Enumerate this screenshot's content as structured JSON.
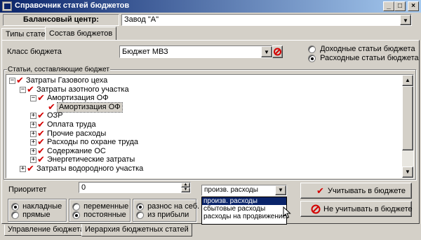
{
  "window": {
    "title": "Справочник статей бюджетов",
    "controls": [
      "_",
      "□",
      "×"
    ]
  },
  "balance_center": {
    "label": "Балансовый центр:",
    "value": "Завод \"А\""
  },
  "top_tabs": [
    {
      "label": "Типы статей",
      "active": false
    },
    {
      "label": "Состав бюджетов",
      "active": true
    }
  ],
  "budget_class": {
    "label": "Класс бюджета",
    "value": "Бюджет МВЗ"
  },
  "budget_type": {
    "options": [
      {
        "label": "Доходные статьи бюджета",
        "selected": false
      },
      {
        "label": "Расходные статьи бюджета",
        "selected": true
      }
    ]
  },
  "tree_group_label": "Статьи, составляющие бюджет",
  "tree": [
    {
      "label": "Затраты Газового цеха",
      "expander": "−",
      "level": 0
    },
    {
      "label": "Затраты азотного участка",
      "expander": "−",
      "level": 1
    },
    {
      "label": "Амортизация ОФ",
      "expander": "−",
      "level": 2
    },
    {
      "label": "Амортизация ОФ",
      "expander": "",
      "level": 3,
      "selected": true
    },
    {
      "label": "ОЗР",
      "expander": "+",
      "level": 2
    },
    {
      "label": "Оплата труда",
      "expander": "+",
      "level": 2
    },
    {
      "label": "Прочие расходы",
      "expander": "+",
      "level": 2
    },
    {
      "label": "Расходы по охране труда",
      "expander": "+",
      "level": 2
    },
    {
      "label": "Содержание ОС",
      "expander": "+",
      "level": 2
    },
    {
      "label": "Энергетические затраты",
      "expander": "+",
      "level": 2
    },
    {
      "label": "Затраты водородного участка",
      "expander": "+",
      "level": 1
    }
  ],
  "priority": {
    "label": "Приоритет",
    "value": "0"
  },
  "category_select": {
    "value": "произв. расходы",
    "options": [
      {
        "label": "произв. расходы",
        "highlighted": true
      },
      {
        "label": "сбытовые расходы",
        "highlighted": false
      },
      {
        "label": "расходы на продвижение",
        "highlighted": false
      }
    ]
  },
  "radio_groups": [
    {
      "options": [
        {
          "label": "накладные",
          "selected": true
        },
        {
          "label": "прямые",
          "selected": false
        }
      ]
    },
    {
      "options": [
        {
          "label": "переменные",
          "selected": false
        },
        {
          "label": "постоянные",
          "selected": true
        }
      ]
    },
    {
      "options": [
        {
          "label": "разнос на себ.",
          "selected": true
        },
        {
          "label": "из прибыли",
          "selected": false
        }
      ]
    }
  ],
  "buttons": {
    "include": "Учитывать в бюджете",
    "exclude": "Не учитывать в бюджете"
  },
  "bottom_tabs": [
    {
      "label": "Управление бюджетами",
      "active": false
    },
    {
      "label": "Иерархия бюджетных статей",
      "active": true
    }
  ],
  "colors": {
    "accent": "#0a246a",
    "check": "#d40000",
    "face": "#d4d0c8"
  }
}
